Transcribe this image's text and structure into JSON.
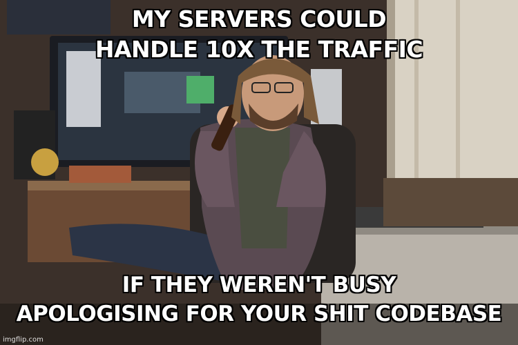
{
  "meme": {
    "top_text": [
      "MY SERVERS COULD",
      "HANDLE 10X THE TRAFFIC"
    ],
    "bottom_text": [
      "IF THEY WEREN'T BUSY",
      "APOLOGISING FOR YOUR SHIT CODEBASE"
    ],
    "watermark": "imgflip.com"
  },
  "photo": {
    "subject": "man drinking beer at office desk",
    "colors": {
      "wall": "#3b302a",
      "window": "#d9d2c4",
      "desk": "#6b4a34",
      "shirt": "#5a4a52",
      "jeans": "#2b3446"
    }
  }
}
